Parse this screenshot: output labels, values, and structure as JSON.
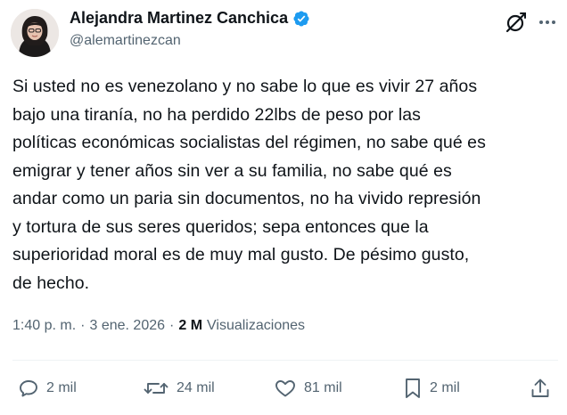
{
  "author": {
    "display_name": "Alejandra Martinez Canchica",
    "handle": "@alemartinezcan",
    "verified": true
  },
  "icons": {
    "verified": "verified-badge-icon",
    "grok": "grok-icon",
    "more": "more-options-icon",
    "reply": "reply-icon",
    "repost": "repost-icon",
    "like": "heart-icon",
    "bookmark": "bookmark-icon",
    "share": "share-icon"
  },
  "tweet": {
    "text": "Si usted no es venezolano y no sabe lo que es vivir 27 años\nbajo una tiranía, no ha perdido 22lbs de peso por las\npolíticas económicas socialistas del régimen, no sabe qué es\nemigrar y tener años sin ver a su familia, no sabe qué es\nandar como un paria sin documentos, no ha vivido represión\ny tortura de sus seres queridos; sepa entonces que la\nsuperioridad moral es de muy mal gusto. De pésimo gusto,\nde hecho."
  },
  "meta": {
    "time": "1:40 p. m.",
    "separator": "·",
    "date": "3 ene. 2026",
    "views_count": "2 M",
    "views_label": "Visualizaciones"
  },
  "actions": {
    "replies": "2 mil",
    "reposts": "24 mil",
    "likes": "81 mil",
    "bookmarks": "2 mil"
  },
  "colors": {
    "text": "#0f1419",
    "secondary": "#536471",
    "verified": "#1d9bf0",
    "divider": "#eff3f4"
  }
}
